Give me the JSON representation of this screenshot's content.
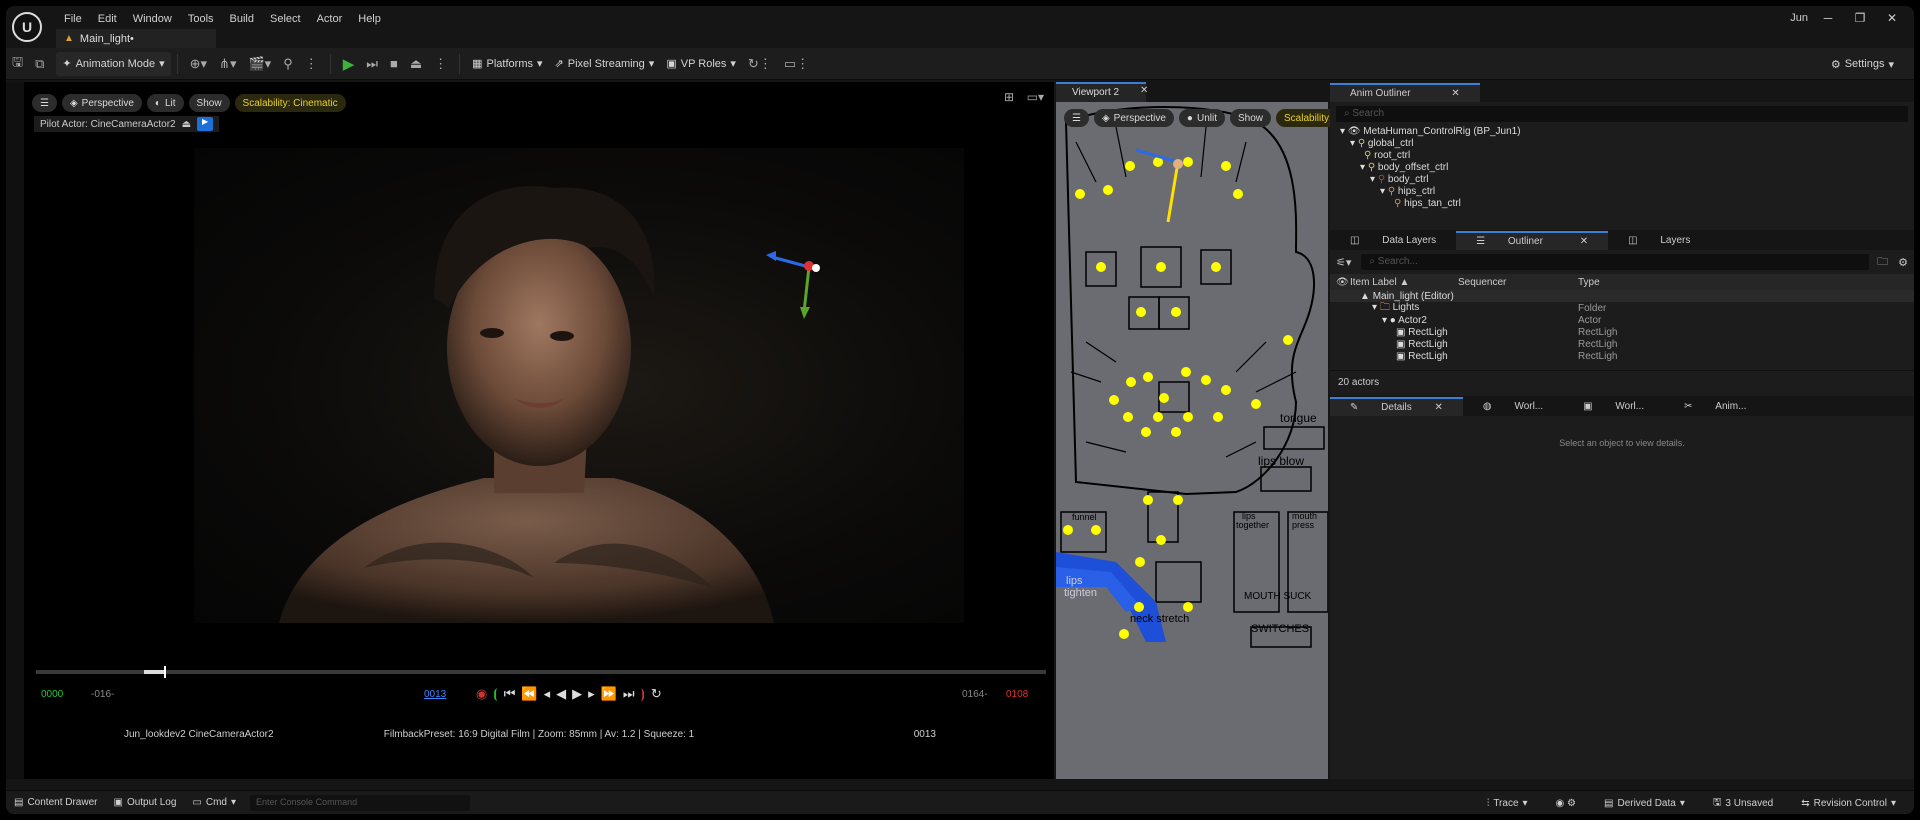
{
  "menubar": {
    "logo": "U",
    "items": [
      "File",
      "Edit",
      "Window",
      "Tools",
      "Build",
      "Select",
      "Actor",
      "Help"
    ],
    "doc_tab": "Main_light•",
    "user": "Jun",
    "win_min": "─",
    "win_max": "❐",
    "win_close": "✕"
  },
  "toolbar": {
    "mode": "Animation Mode",
    "platforms": "Platforms",
    "pixel_streaming": "Pixel Streaming",
    "vp_roles": "VP Roles",
    "settings": "Settings"
  },
  "viewport": {
    "perspective": "Perspective",
    "lit": "Lit",
    "show": "Show",
    "scalability": "Scalability: Cinematic",
    "pilot": "Pilot Actor: CineCameraActor2",
    "overlay_left": "Jun_lookdev2 CineCameraActor2",
    "overlay_center": "FilmbackPreset: 16:9 Digital Film | Zoom: 85mm | Av: 1.2 | Squeeze: 1",
    "overlay_right": "0013",
    "frame_start": "0000",
    "frame_pre": "-016-",
    "frame_current": "0013",
    "frame_post": "0164-",
    "frame_end": "0108",
    "timeline_progress": 0.127
  },
  "viewport2": {
    "tab": "Viewport 2",
    "perspective": "Perspective",
    "unlit": "Unlit",
    "show": "Show",
    "scalability": "Scalability: Cinematic",
    "labels": {
      "tongue": "tongue",
      "lips_blow": "lips blow",
      "funnel": "funnel",
      "lips_together_1": "lips",
      "lips_together_2": "together",
      "mouth_press_1": "mouth",
      "mouth_press_2": "press",
      "lips_tighten_1": "lips",
      "lips_tighten_2": "tighten",
      "mouth_suck": "MOUTH SUCK",
      "neck_stretch": "neck stretch",
      "switches": "SWITCHES"
    }
  },
  "anim_outliner": {
    "tab": "Anim Outliner",
    "search": "Search",
    "items": [
      "MetaHuman_ControlRig (BP_Jun1)",
      "global_ctrl",
      "root_ctrl",
      "body_offset_ctrl",
      "body_ctrl",
      "hips_ctrl",
      "hips_tan_ctrl"
    ]
  },
  "outliner": {
    "tabs": [
      "Data Layers",
      "Outliner",
      "Layers"
    ],
    "search": "Search...",
    "columns": [
      "Item Label ▲",
      "Sequencer",
      "Type"
    ],
    "rows": [
      {
        "label": "Main_light (Editor)",
        "type": ""
      },
      {
        "label": "Lights",
        "type": "Folder"
      },
      {
        "label": "Actor2",
        "type": "Actor"
      },
      {
        "label": "RectLigh",
        "type": "RectLigh"
      },
      {
        "label": "RectLigh",
        "type": "RectLigh"
      },
      {
        "label": "RectLigh",
        "type": "RectLigh"
      }
    ],
    "count": "20 actors"
  },
  "details": {
    "tabs": [
      "Details",
      "Worl...",
      "Worl...",
      "Anim..."
    ],
    "empty": "Select an object to view details."
  },
  "statusbar": {
    "content_drawer": "Content Drawer",
    "output_log": "Output Log",
    "cmd": "Cmd",
    "console_placeholder": "Enter Console Command",
    "trace": "Trace",
    "derived_data": "Derived Data",
    "unsaved": "3 Unsaved",
    "revision": "Revision Control"
  }
}
